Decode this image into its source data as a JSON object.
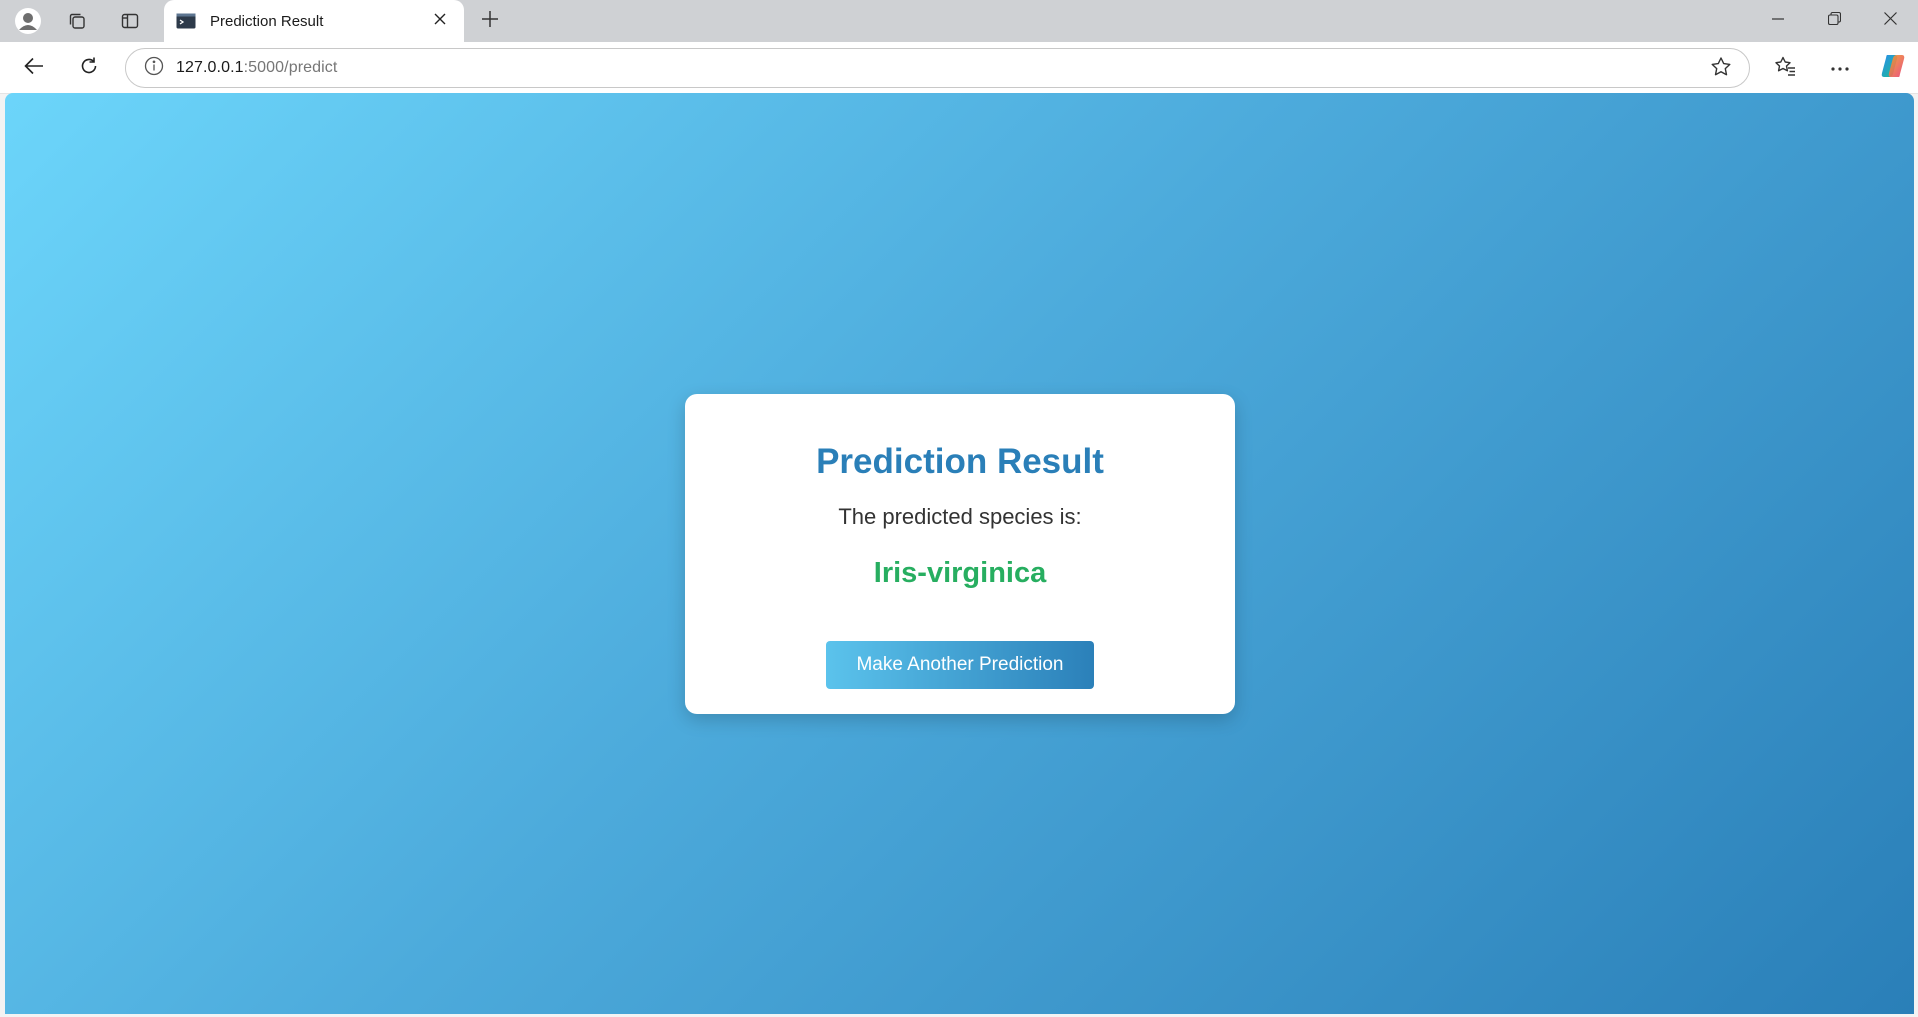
{
  "browser": {
    "tab": {
      "title": "Prediction Result"
    },
    "address": {
      "host": "127.0.0.1",
      "path": ":5000/predict"
    }
  },
  "page": {
    "title": "Prediction Result",
    "subtitle": "The predicted species is:",
    "result": "Iris-virginica",
    "button_label": "Make Another Prediction"
  },
  "colors": {
    "title": "#2a7fb8",
    "result": "#27ae60",
    "gradient_start": "#6cd5fa",
    "gradient_end": "#2a7fb8"
  },
  "icons": {
    "profile": "profile-icon",
    "workspaces": "workspaces-icon",
    "vertical_tabs": "vertical-tabs-icon",
    "favicon": "terminal-favicon-icon",
    "close_tab": "close-icon",
    "new_tab": "plus-icon",
    "minimize": "minimize-icon",
    "restore": "restore-icon",
    "close_window": "close-window-icon",
    "back": "back-arrow-icon",
    "refresh": "refresh-icon",
    "site_info": "info-icon",
    "favorite": "star-icon",
    "favorites": "favorites-icon",
    "more": "more-icon",
    "copilot": "copilot-icon"
  }
}
